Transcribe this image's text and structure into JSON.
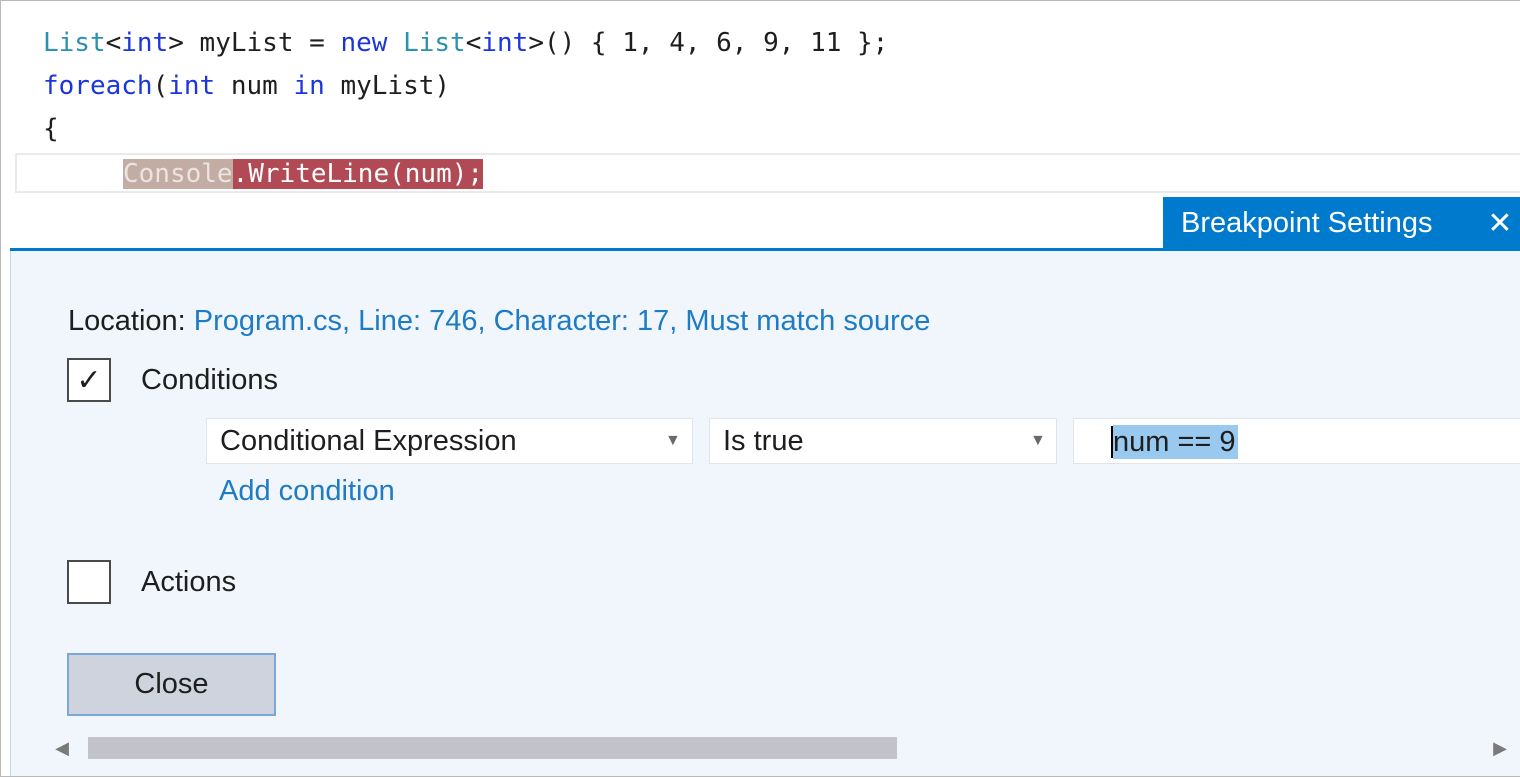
{
  "editor": {
    "lines": [
      {
        "t1": "List",
        "t2": "<",
        "t3": "int",
        "t4": "> myList = ",
        "t5": "new",
        "t6": " ",
        "t7": "List",
        "t8": "<",
        "t9": "int",
        "t10": ">() { 1, 4, 6, 9, 11 };"
      },
      {
        "t1": "foreach",
        "t2": "(",
        "t3": "int",
        "t4": " num ",
        "t5": "in",
        "t6": " myList)"
      },
      {
        "t1": "{"
      }
    ],
    "breakpoint_line": {
      "dim": "Console",
      "highlight": ".WriteLine(num);"
    }
  },
  "peek": {
    "title": "Breakpoint Settings",
    "close_glyph": "✕",
    "accent": "#007acc"
  },
  "settings": {
    "location_label": "Location:",
    "location_value": "Program.cs, Line: 746, Character: 17, Must match source",
    "conditions": {
      "label": "Conditions",
      "checked": true,
      "check_glyph": "✓",
      "type_value": "Conditional Expression",
      "operator_value": "Is true",
      "expression": "num == 9",
      "add_link": "Add condition"
    },
    "actions": {
      "label": "Actions",
      "checked": false
    },
    "close_label": "Close"
  },
  "scrollbar": {
    "left_arrow": "◀",
    "right_arrow": "▶",
    "position_fraction": 0.0
  }
}
